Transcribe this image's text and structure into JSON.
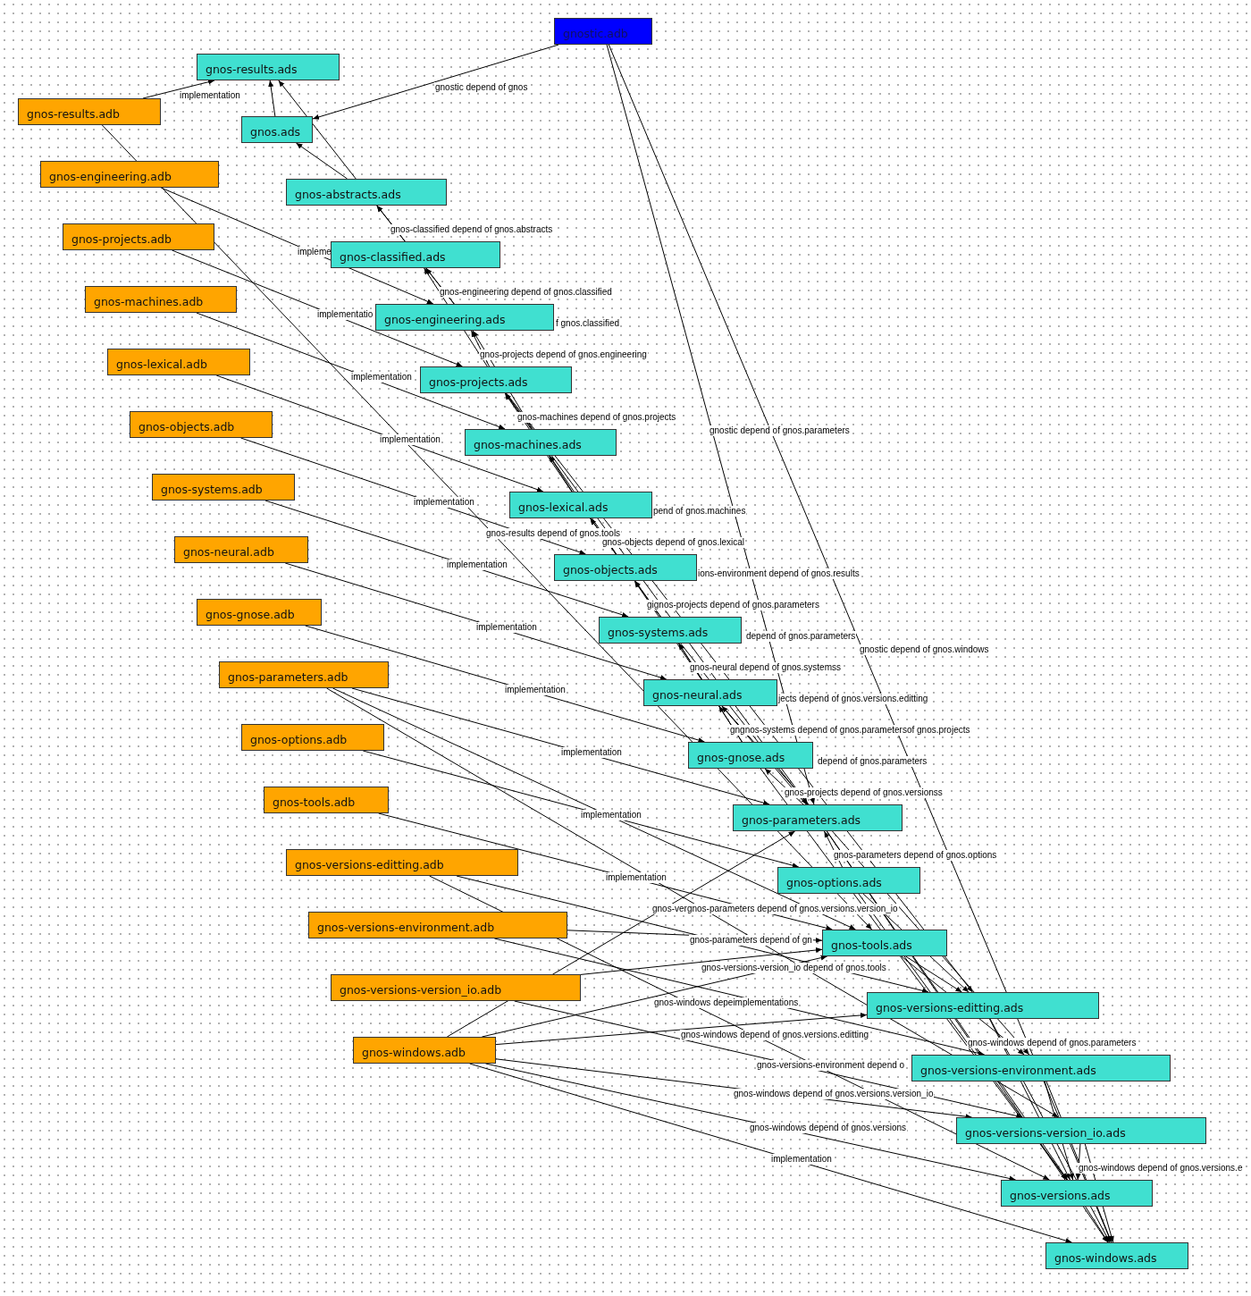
{
  "canvas": {
    "nodes": [
      {
        "label": "gnostic.adb",
        "kind": "main"
      },
      {
        "label": "gnos-results.ads",
        "kind": "spec"
      },
      {
        "label": "gnos.ads",
        "kind": "spec"
      },
      {
        "label": "gnos-abstracts.ads",
        "kind": "spec"
      },
      {
        "label": "gnos-classified.ads",
        "kind": "spec"
      },
      {
        "label": "gnos-engineering.ads",
        "kind": "spec"
      },
      {
        "label": "gnos-projects.ads",
        "kind": "spec"
      },
      {
        "label": "gnos-machines.ads",
        "kind": "spec"
      },
      {
        "label": "gnos-lexical.ads",
        "kind": "spec"
      },
      {
        "label": "gnos-objects.ads",
        "kind": "spec"
      },
      {
        "label": "gnos-systems.ads",
        "kind": "spec"
      },
      {
        "label": "gnos-neural.ads",
        "kind": "spec"
      },
      {
        "label": "gnos-gnose.ads",
        "kind": "spec"
      },
      {
        "label": "gnos-parameters.ads",
        "kind": "spec"
      },
      {
        "label": "gnos-options.ads",
        "kind": "spec"
      },
      {
        "label": "gnos-tools.ads",
        "kind": "spec"
      },
      {
        "label": "gnos-versions-editting.ads",
        "kind": "spec"
      },
      {
        "label": "gnos-versions-environment.ads",
        "kind": "spec"
      },
      {
        "label": "gnos-versions-version_io.ads",
        "kind": "spec"
      },
      {
        "label": "gnos-versions.ads",
        "kind": "spec"
      },
      {
        "label": "gnos-windows.ads",
        "kind": "spec"
      },
      {
        "label": "gnos-results.adb",
        "kind": "body"
      },
      {
        "label": "gnos-engineering.adb",
        "kind": "body"
      },
      {
        "label": "gnos-projects.adb",
        "kind": "body"
      },
      {
        "label": "gnos-machines.adb",
        "kind": "body"
      },
      {
        "label": "gnos-lexical.adb",
        "kind": "body"
      },
      {
        "label": "gnos-objects.adb",
        "kind": "body"
      },
      {
        "label": "gnos-systems.adb",
        "kind": "body"
      },
      {
        "label": "gnos-neural.adb",
        "kind": "body"
      },
      {
        "label": "gnos-gnose.adb",
        "kind": "body"
      },
      {
        "label": "gnos-parameters.adb",
        "kind": "body"
      },
      {
        "label": "gnos-options.adb",
        "kind": "body"
      },
      {
        "label": "gnos-tools.adb",
        "kind": "body"
      },
      {
        "label": "gnos-versions-editting.adb",
        "kind": "body"
      },
      {
        "label": "gnos-versions-environment.adb",
        "kind": "body"
      },
      {
        "label": "gnos-versions-version_io.adb",
        "kind": "body"
      },
      {
        "label": "gnos-windows.adb",
        "kind": "body"
      }
    ],
    "edge_labels": [
      "gnostic depend of gnos",
      "implementation",
      "gnos-classified depend of gnos.abstracts",
      "impleme",
      "gnos-engineering depend of gnos.classified",
      "implementatio",
      "f gnos.classified",
      "gnos-projects depend of gnos.engineering",
      "implementation",
      "gnos-machines depend of gnos.projects",
      "gnostic depend of gnos.parameters",
      "implementation",
      "implementation",
      "pend of gnos.machines",
      "gnos-results depend of gnos.tools",
      "gnos-objects depend of gnos.lexical",
      "ions-environment depend of gnos.results",
      "implementation",
      "gignos-projects depend of gnos.parameters",
      "depend of gnos.parameters",
      "gnostic depend of gnos.windows",
      "implementation",
      "gnos-neural depend of gnos.systemss",
      "jects depend of gnos.versions.editting",
      "implementation",
      "gngnos-systems depend of gnos.parametersof gnos.projects",
      "implementation",
      "depend of gnos.parameters",
      "gnos-projects depend of gnos.versionss",
      "implementation",
      "gnos-parameters depend of gnos.options",
      "implementation",
      "gnos-vergnos-parameters depend of gnos.versions.version_io",
      "gnos-parameters depend of gn",
      "gnos-versions-version_io depend of gnos.tools",
      "gnos-windows depeimplementations",
      "gnos-windows depend of gnos.versions.editting",
      "gnos-windows depend of gnos.parameters",
      "gnos-versions-environment depend o",
      "gnos-windows depend of gnos.versions.version_io",
      "gnos-windows depend of gnos.versions",
      "implementation",
      "gnos-windows depend of gnos.versions.e"
    ]
  }
}
